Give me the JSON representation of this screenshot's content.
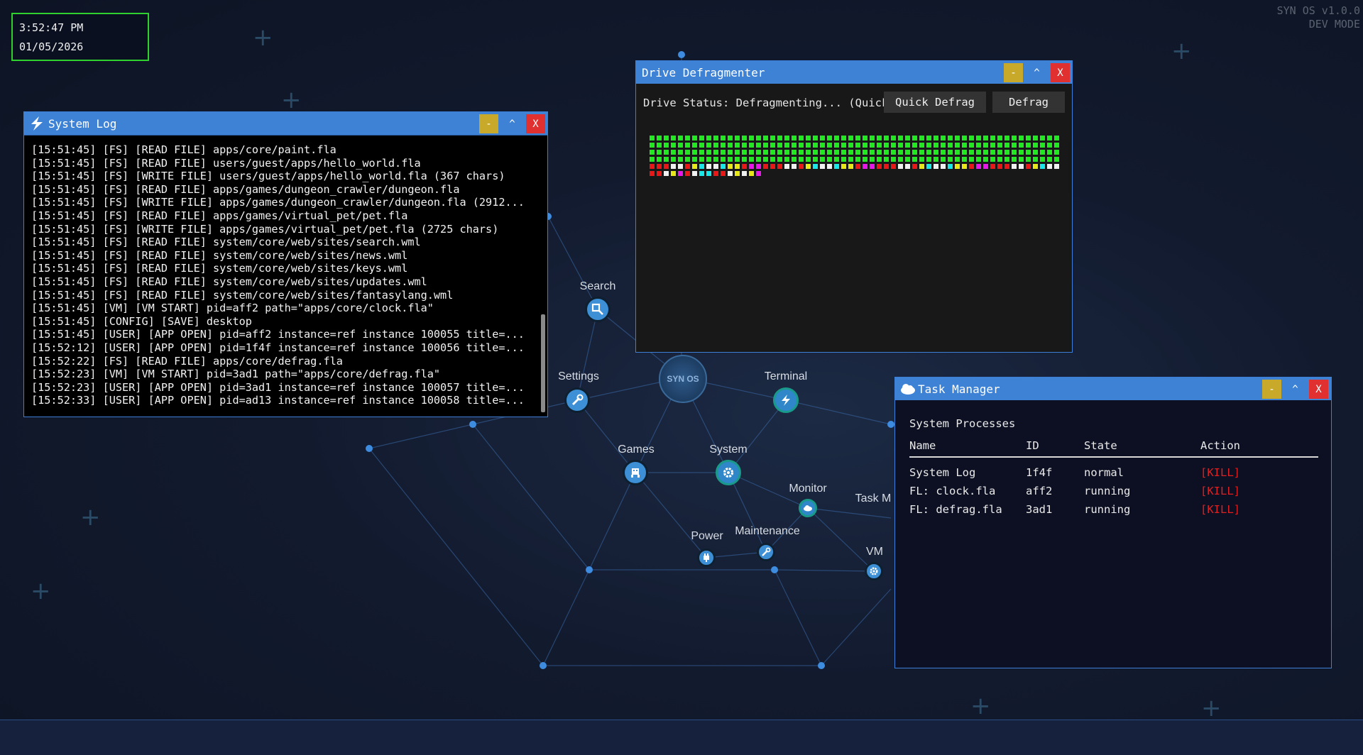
{
  "clock": {
    "time": "3:52:47 PM",
    "date": "01/05/2026"
  },
  "version": {
    "name": "SYN OS v1.0.0",
    "mode": "DEV MODE"
  },
  "hub": {
    "label": "SYN OS"
  },
  "desktop_nodes": {
    "search": {
      "label": "Search",
      "icon": "magnifier-icon"
    },
    "settings": {
      "label": "Settings",
      "icon": "wrench-icon"
    },
    "terminal": {
      "label": "Terminal",
      "icon": "lightning-icon"
    },
    "games": {
      "label": "Games",
      "icon": "space-invader-icon"
    },
    "system": {
      "label": "System",
      "icon": "gear-icon"
    },
    "monitor": {
      "label": "Monitor",
      "icon": "cloud-icon"
    },
    "task": {
      "label": "Task M",
      "icon": "task-icon"
    },
    "power": {
      "label": "Power",
      "icon": "plug-icon"
    },
    "maintenance": {
      "label": "Maintenance",
      "icon": "wrench-icon"
    },
    "vm": {
      "label": "VM",
      "icon": "gear-icon"
    }
  },
  "system_log": {
    "title": "System Log",
    "lines": [
      "[15:51:45] [FS] [READ FILE] apps/core/paint.fla",
      "[15:51:45] [FS] [READ FILE] users/guest/apps/hello_world.fla",
      "[15:51:45] [FS] [WRITE FILE] users/guest/apps/hello_world.fla (367 chars)",
      "[15:51:45] [FS] [READ FILE] apps/games/dungeon_crawler/dungeon.fla",
      "[15:51:45] [FS] [WRITE FILE] apps/games/dungeon_crawler/dungeon.fla (2912...",
      "[15:51:45] [FS] [READ FILE] apps/games/virtual_pet/pet.fla",
      "[15:51:45] [FS] [WRITE FILE] apps/games/virtual_pet/pet.fla (2725 chars)",
      "[15:51:45] [FS] [READ FILE] system/core/web/sites/search.wml",
      "[15:51:45] [FS] [READ FILE] system/core/web/sites/news.wml",
      "[15:51:45] [FS] [READ FILE] system/core/web/sites/keys.wml",
      "[15:51:45] [FS] [READ FILE] system/core/web/sites/updates.wml",
      "[15:51:45] [FS] [READ FILE] system/core/web/sites/fantasylang.wml",
      "[15:51:45] [VM] [VM START] pid=aff2 path=\"apps/core/clock.fla\"",
      "[15:51:45] [CONFIG] [SAVE] desktop",
      "[15:51:45] [USER] [APP OPEN] pid=aff2 instance=ref instance 100055 title=...",
      "[15:52:12] [USER] [APP OPEN] pid=1f4f instance=ref instance 100056 title=...",
      "[15:52:22] [FS] [READ FILE] apps/core/defrag.fla",
      "[15:52:23] [VM] [VM START] pid=3ad1 path=\"apps/core/defrag.fla\"",
      "[15:52:23] [USER] [APP OPEN] pid=3ad1 instance=ref instance 100057 title=...",
      "[15:52:33] [USER] [APP OPEN] pid=ad13 instance=ref instance 100058 title=..."
    ]
  },
  "window_buttons": {
    "minimize": "-",
    "maximize": "^",
    "close": "X"
  },
  "defrag": {
    "title": "Drive Defragmenter",
    "status": "Drive Status: Defragmenting... (Quick Defrag)",
    "quick_button": "Quick Defrag",
    "defrag_button": "Defrag",
    "block_colors": {
      "done": "#22e822",
      "red": "#e81818",
      "yellow": "#e8e818",
      "white": "#f0f0f0",
      "cyan": "#18e8e8",
      "magenta": "#e818e8"
    }
  },
  "task_manager": {
    "title": "Task Manager",
    "heading": "System Processes",
    "columns": [
      "Name",
      "ID",
      "State",
      "Action"
    ],
    "rows": [
      {
        "name": "System Log",
        "id": "1f4f",
        "state": "normal",
        "action": "[KILL]"
      },
      {
        "name": "FL: clock.fla",
        "id": "aff2",
        "state": "running",
        "action": "[KILL]"
      },
      {
        "name": "FL: defrag.fla",
        "id": "3ad1",
        "state": "running",
        "action": "[KILL]"
      }
    ]
  },
  "colors": {
    "accent": "#3e82d6",
    "clock_border": "#2fd12f",
    "kill": "#e02020"
  }
}
